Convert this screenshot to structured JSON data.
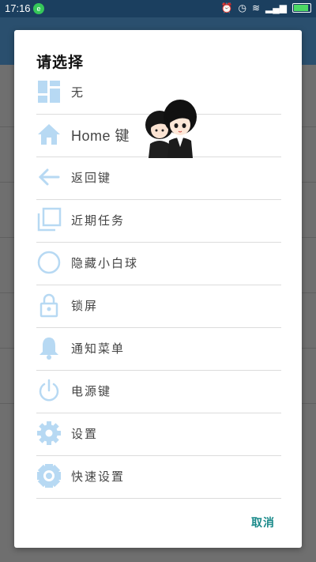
{
  "status_bar": {
    "time": "17:16",
    "notification_badge": "e",
    "icons": [
      "alarm-icon",
      "clock-icon",
      "wifi-icon",
      "signal-icon",
      "battery-icon"
    ]
  },
  "dialog": {
    "title": "请选择",
    "options": [
      {
        "label": "无",
        "icon": "grid-icon"
      },
      {
        "label": "Home 键",
        "icon": "home-icon"
      },
      {
        "label": "返回键",
        "icon": "back-arrow-icon"
      },
      {
        "label": "近期任务",
        "icon": "recent-tasks-icon"
      },
      {
        "label": "隐藏小白球",
        "icon": "circle-icon"
      },
      {
        "label": "锁屏",
        "icon": "lock-icon"
      },
      {
        "label": "通知菜单",
        "icon": "bell-icon"
      },
      {
        "label": "电源键",
        "icon": "power-icon"
      },
      {
        "label": "设置",
        "icon": "gear-icon"
      },
      {
        "label": "快速设置",
        "icon": "quick-settings-icon"
      }
    ],
    "cancel_label": "取消"
  },
  "colors": {
    "icon": "#b7d9f3",
    "accent": "#1a8a8a",
    "status_bar": "#1b3f5f",
    "app_bar": "#2a4f6e"
  }
}
